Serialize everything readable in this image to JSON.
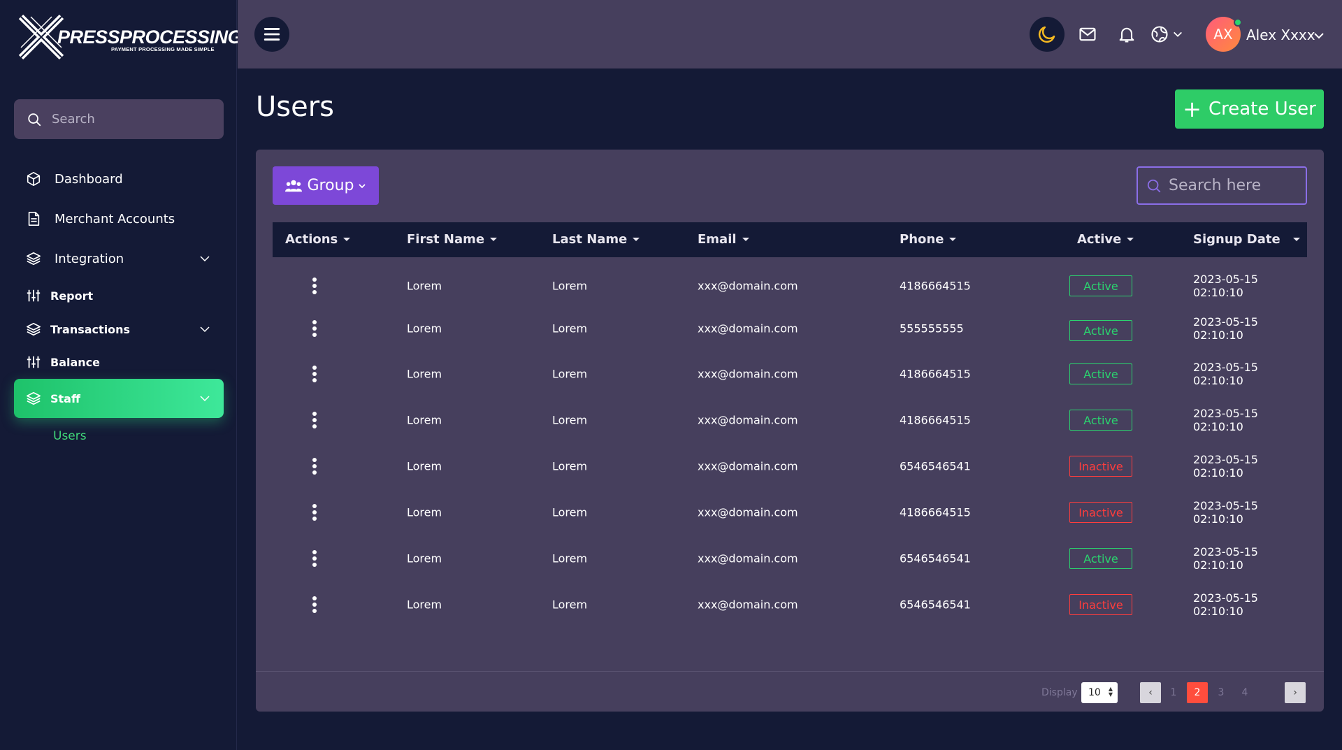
{
  "brand": {
    "name": "PRESSPROCESSING",
    "tagline": "PAYMENT PROCESSING MADE SIMPLE"
  },
  "sidebar": {
    "search_placeholder": "Search",
    "items": [
      {
        "label": "Dashboard",
        "icon": "cube-icon"
      },
      {
        "label": "Merchant Accounts",
        "icon": "document-icon"
      },
      {
        "label": "Integration",
        "icon": "layers-icon",
        "expandable": true
      },
      {
        "label": "Report",
        "icon": "sliders-icon"
      },
      {
        "label": "Transactions",
        "icon": "layers-icon",
        "expandable": true
      },
      {
        "label": "Balance",
        "icon": "sliders-icon"
      },
      {
        "label": "Staff",
        "icon": "layers-icon",
        "expandable": true,
        "active": true
      }
    ],
    "sub_items": [
      {
        "label": "Users",
        "active": true
      }
    ]
  },
  "topbar": {
    "user": {
      "initials": "AX",
      "name": "Alex Xxxx"
    }
  },
  "main": {
    "title": "Users",
    "create_button": "Create User",
    "group_button": "Group",
    "search_placeholder": "Search here",
    "columns": [
      "Actions",
      "First Name",
      "Last Name",
      "Email",
      "Phone",
      "Active",
      "Signup Date"
    ],
    "rows": [
      {
        "first": "Lorem",
        "last": "Lorem",
        "email": "xxx@domain.com",
        "phone": "4186664515",
        "status": "Active",
        "signup": "2023-05-15 02:10:10"
      },
      {
        "first": "Lorem",
        "last": "Lorem",
        "email": "xxx@domain.com",
        "phone": "555555555",
        "status": "Active",
        "signup": "2023-05-15 02:10:10"
      },
      {
        "first": "Lorem",
        "last": "Lorem",
        "email": "xxx@domain.com",
        "phone": "4186664515",
        "status": "Active",
        "signup": "2023-05-15 02:10:10"
      },
      {
        "first": "Lorem",
        "last": "Lorem",
        "email": "xxx@domain.com",
        "phone": "4186664515",
        "status": "Active",
        "signup": "2023-05-15 02:10:10"
      },
      {
        "first": "Lorem",
        "last": "Lorem",
        "email": "xxx@domain.com",
        "phone": "6546546541",
        "status": "Inactive",
        "signup": "2023-05-15 02:10:10"
      },
      {
        "first": "Lorem",
        "last": "Lorem",
        "email": "xxx@domain.com",
        "phone": "4186664515",
        "status": "Inactive",
        "signup": "2023-05-15 02:10:10"
      },
      {
        "first": "Lorem",
        "last": "Lorem",
        "email": "xxx@domain.com",
        "phone": "6546546541",
        "status": "Active",
        "signup": "2023-05-15 02:10:10"
      },
      {
        "first": "Lorem",
        "last": "Lorem",
        "email": "xxx@domain.com",
        "phone": "6546546541",
        "status": "Inactive",
        "signup": "2023-05-15 02:10:10"
      }
    ],
    "pagination": {
      "display_label": "Display",
      "page_size": "10",
      "pages": [
        "1",
        "2",
        "3",
        "4"
      ],
      "current": "2",
      "prev": "‹",
      "next": "›"
    }
  },
  "colors": {
    "accent_green": "#2ecc67",
    "active_green": "#2bd46f",
    "inactive_red": "#ff3d3d",
    "group_purple": "#7d48d8",
    "panel": "#463f5d",
    "bg": "#141a36"
  }
}
